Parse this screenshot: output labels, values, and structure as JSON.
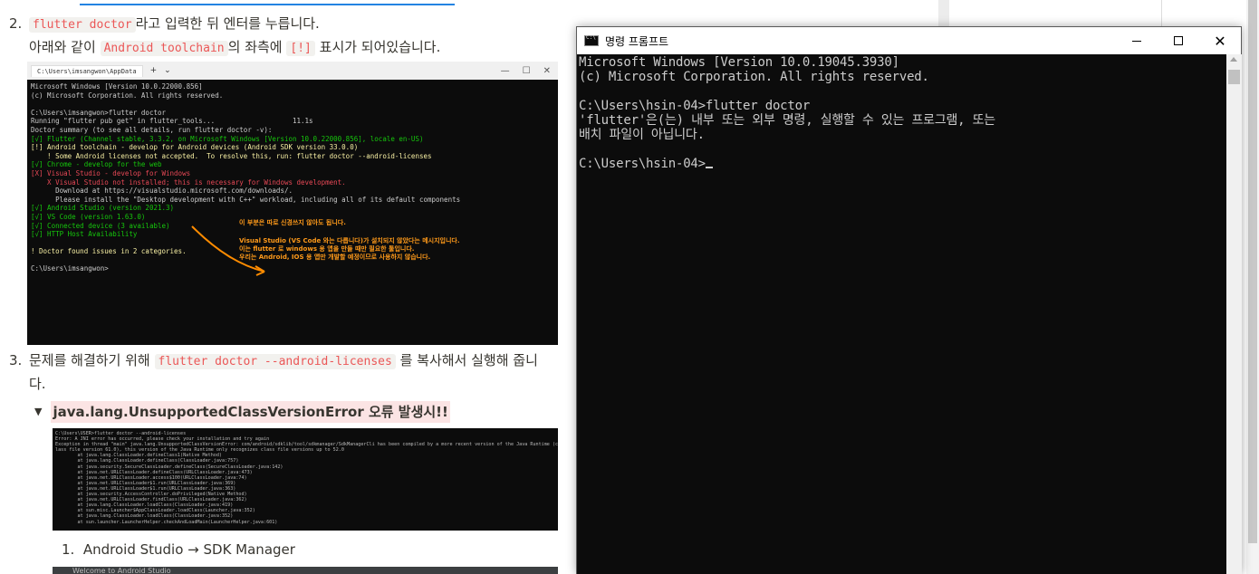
{
  "blog": {
    "step2": {
      "number": "2.",
      "code1": "flutter doctor",
      "text1": "라고 입력한 뒤 엔터를 누릅니다.",
      "text2": "아래와 같이",
      "code2": "Android toolchain",
      "text3": "의 좌측에",
      "code3": "[!]",
      "text4": "표시가 되어있습니다."
    },
    "screenshot1": {
      "tab_title": "C:\\Users\\imsangwon\\AppData",
      "tab_plus": "+",
      "tab_dropdown": "⌄",
      "lines": [
        "Microsoft Windows [Version 10.0.22000.856]",
        "(c) Microsoft Corporation. All rights reserved.",
        "",
        "C:\\Users\\imsangwon>flutter doctor",
        "Running \"flutter pub get\" in flutter_tools...                   11.1s",
        "Doctor summary (to see all details, run flutter doctor -v):",
        "[√] Flutter (Channel stable, 3.3.2, on Microsoft Windows [Version 10.0.22000.856], locale en-US)",
        "[!] Android toolchain - develop for Android devices (Android SDK version 33.0.0)",
        "    ! Some Android licenses not accepted.  To resolve this, run: flutter doctor --android-licenses",
        "[√] Chrome - develop for the web",
        "[X] Visual Studio - develop for Windows",
        "    X Visual Studio not installed; this is necessary for Windows development.",
        "      Download at https://visualstudio.microsoft.com/downloads/.",
        "      Please install the \"Desktop development with C++\" workload, including all of its default components",
        "[√] Android Studio (version 2021.3)",
        "[√] VS Code (version 1.63.0)",
        "[√] Connected device (3 available)",
        "[√] HTTP Host Availability",
        "",
        "! Doctor found issues in 2 categories.",
        "",
        "C:\\Users\\imsangwon>"
      ],
      "annotation1": "이 부분은 따로 신경쓰지 않아도 됩니다.",
      "annotation2": [
        "Visual Studio (VS Code 와는 다릅니다)가 설치되지 않았다는 메시지입니다.",
        "이는 flutter 로 windows 용 앱을 만들 때만 필요한 툴입니다.",
        "우리는 Android, IOS 용 앱만 개발할 예정이므로 사용하지 않습니다."
      ]
    },
    "step3": {
      "number": "3.",
      "text1": "문제를 해결하기 위해",
      "code1": "flutter doctor --android-licenses",
      "text2": "를 복사해서 실행해 줍니",
      "text3": "다."
    },
    "toggle": {
      "arrow": "▼",
      "label": "java.lang.UnsupportedClassVersionError 오류 발생시!!"
    },
    "screenshot2": {
      "lines": [
        "C:\\Users\\USER>flutter doctor --android-licenses",
        "Error: A JNI error has occurred, please check your installation and try again",
        "Exception in thread \"main\" java.lang.UnsupportedClassVersionError: com/android/sdklib/tool/sdkmanager/SdkManagerCli has been compiled by a more recent version of the Java Runtime (c",
        "lass file version 61.0), this version of the Java Runtime only recognizes class file versions up to 52.0",
        "        at java.lang.ClassLoader.defineClass1(Native Method)",
        "        at java.lang.ClassLoader.defineClass(ClassLoader.java:757)",
        "        at java.security.SecureClassLoader.defineClass(SecureClassLoader.java:142)",
        "        at java.net.URLClassLoader.defineClass(URLClassLoader.java:473)",
        "        at java.net.URLClassLoader.access$100(URLClassLoader.java:74)",
        "        at java.net.URLClassLoader$1.run(URLClassLoader.java:369)",
        "        at java.net.URLClassLoader$1.run(URLClassLoader.java:363)",
        "        at java.security.AccessController.doPrivileged(Native Method)",
        "        at java.net.URLClassLoader.findClass(URLClassLoader.java:362)",
        "        at java.lang.ClassLoader.loadClass(ClassLoader.java:419)",
        "        at sun.misc.Launcher$AppClassLoader.loadClass(Launcher.java:352)",
        "        at java.lang.ClassLoader.loadClass(ClassLoader.java:352)",
        "        at sun.launcher.LauncherHelper.checkAndLoadMain(LauncherHelper.java:601)"
      ]
    },
    "sub_step": {
      "number": "1.",
      "text": "Android Studio → SDK Manager"
    },
    "screenshot3": {
      "title": "Welcome to Android Studio"
    }
  },
  "cmd": {
    "title": "명령 프롬프트",
    "lines": [
      "Microsoft Windows [Version 10.0.19045.3930]",
      "(c) Microsoft Corporation. All rights reserved.",
      "",
      "C:\\Users\\hsin-04>flutter doctor",
      "'flutter'은(는) 내부 또는 외부 명령, 실행할 수 있는 프로그램, 또는",
      "배치 파일이 아닙니다.",
      "",
      "C:\\Users\\hsin-04>"
    ],
    "buttons": {
      "minimize": "minimize",
      "maximize": "maximize",
      "close": "✕"
    }
  }
}
